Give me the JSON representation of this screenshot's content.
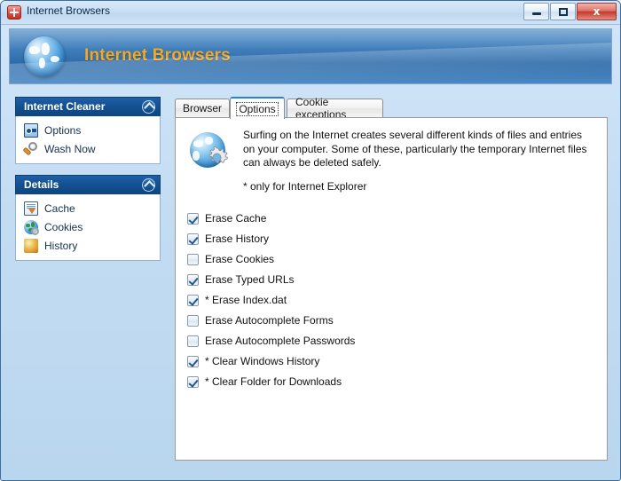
{
  "window": {
    "title": "Internet Browsers",
    "icon": "app-red-cross-icon",
    "controls": {
      "minimize": "Minimize",
      "maximize": "Maximize",
      "close": "Close",
      "close_glyph": "x"
    }
  },
  "banner": {
    "title": "Internet Browsers",
    "icon": "globe-icon",
    "accent_color": "#f6a823",
    "background_color": "#3d7cb9"
  },
  "sidebar": {
    "panels": [
      {
        "title": "Internet Cleaner",
        "collapse_icon": "chevron-up-icon",
        "items": [
          {
            "label": "Options",
            "icon": "options-window-icon"
          },
          {
            "label": "Wash Now",
            "icon": "magnifier-wash-icon"
          }
        ]
      },
      {
        "title": "Details",
        "collapse_icon": "chevron-up-icon",
        "items": [
          {
            "label": "Cache",
            "icon": "cache-download-icon"
          },
          {
            "label": "Cookies",
            "icon": "cookies-globe-search-icon"
          },
          {
            "label": "History",
            "icon": "history-globe-icon"
          }
        ]
      }
    ]
  },
  "tabs": [
    {
      "label": "Browser",
      "selected": false
    },
    {
      "label": "Options",
      "selected": true
    },
    {
      "label": "Cookie exceptions",
      "selected": false
    }
  ],
  "content": {
    "icon": "globe-gear-icon",
    "description": "Surfing on the Internet creates several different kinds of files and entries on your computer. Some of these, particularly the temporary Internet files can always be deleted safely.",
    "note": "*  only for Internet Explorer",
    "checkboxes": [
      {
        "label": "Erase Cache",
        "checked": true
      },
      {
        "label": "Erase History",
        "checked": true
      },
      {
        "label": "Erase Cookies",
        "checked": false
      },
      {
        "label": "Erase Typed URLs",
        "checked": true
      },
      {
        "label": "* Erase Index.dat",
        "checked": true
      },
      {
        "label": "Erase Autocomplete Forms",
        "checked": false
      },
      {
        "label": "Erase Autocomplete Passwords",
        "checked": false
      },
      {
        "label": "* Clear Windows History",
        "checked": true
      },
      {
        "label": "* Clear Folder for Downloads",
        "checked": true
      }
    ]
  }
}
